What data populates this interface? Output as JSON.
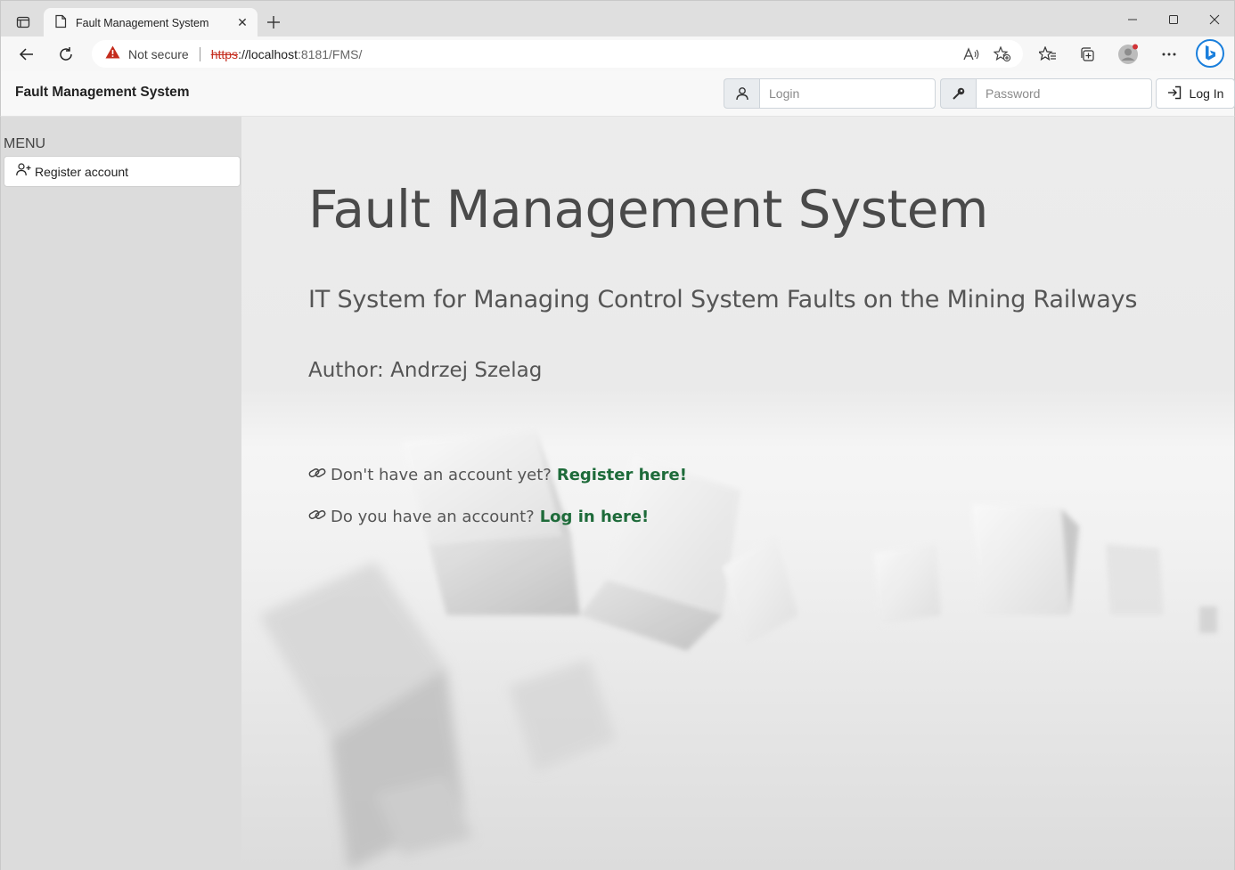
{
  "browser": {
    "tab_title": "Fault Management System",
    "not_secure_label": "Not secure",
    "url_protocol": "https",
    "url_host": "://localhost",
    "url_port": ":8181",
    "url_path": "/FMS/"
  },
  "header": {
    "brand": "Fault Management System",
    "login_placeholder": "Login",
    "password_placeholder": "Password",
    "login_button": "Log In"
  },
  "sidebar": {
    "menu_title": "MENU",
    "items": [
      {
        "label": "Register account",
        "icon": "user-plus-icon"
      }
    ]
  },
  "main": {
    "title": "Fault Management System",
    "subtitle": "IT System for Managing Control System Faults on the Mining Railways",
    "author": "Author: Andrzej Szelag",
    "register_prompt": "Don't have an account yet?",
    "register_link": "Register here!",
    "login_prompt": "Do you have an account?",
    "login_link": "Log in here!"
  },
  "colors": {
    "link_green": "#1e6b3a",
    "sidebar_bg": "#dcdcdc",
    "insecure_red": "#c42b1c"
  }
}
